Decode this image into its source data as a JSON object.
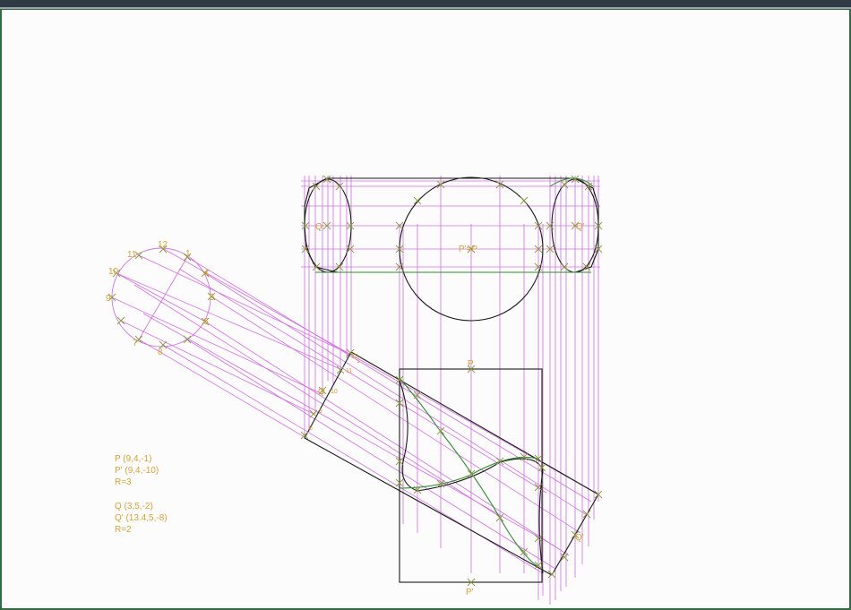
{
  "window": {
    "frame_color": "#2f6f3f",
    "titlebar_color": "#2f3a44"
  },
  "colors": {
    "outline": "#1a1a1a",
    "projector": "#d070e0",
    "curve": "#2e8b2e",
    "marker": "#c8a040",
    "label": "#d4a23c"
  },
  "icons": [
    "cross-marker-icon"
  ],
  "info_block_1": {
    "line1": "P (9,4,-1)",
    "line2": "P' (9,4,-10)",
    "line3": "R=3"
  },
  "info_block_2": {
    "line1": "Q (3,5,-2)",
    "line2": "Q' (13.4,5,-8)",
    "line3": "R=2"
  },
  "labels": {
    "p_top": "P'=P",
    "q_top_left": "Q",
    "q_top_right": "Q'",
    "p_front": "P",
    "p_prime_front": "P'",
    "q_front": "Q",
    "q_prime_front": "Q'",
    "aux_numbers": [
      "1",
      "4",
      "5",
      "6",
      "7",
      "8",
      "9",
      "10",
      "11",
      "12"
    ],
    "small_numbers": [
      "10",
      "11",
      "8",
      "9",
      "12",
      "1"
    ]
  }
}
